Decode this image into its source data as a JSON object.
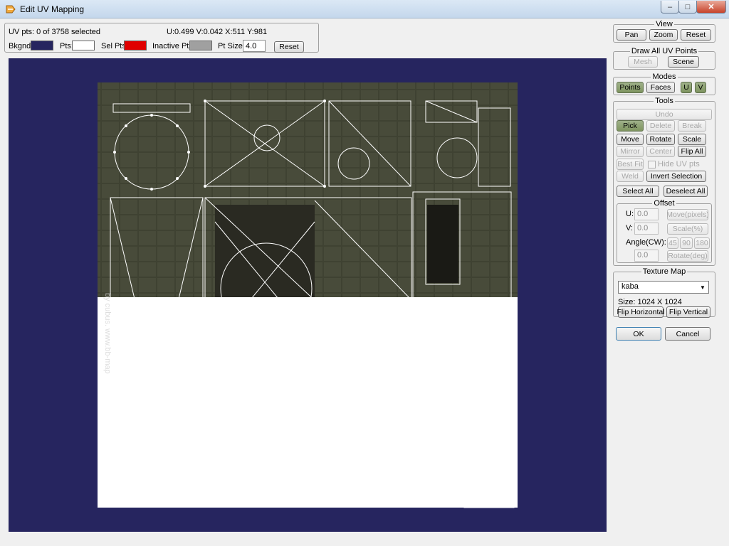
{
  "window": {
    "title": "Edit UV Mapping",
    "minimize": "–",
    "maximize": "□",
    "close": "✕"
  },
  "info": {
    "uv_pts": "UV pts: 0 of 3758 selected",
    "coords": "U:0.499  V:0.042  X:511  Y:981",
    "bkgnd_label": "Bkgnd:",
    "pts_label": "Pts:",
    "sel_pts_label": "Sel Pts:",
    "inactive_pts_label": "Inactive Pts:",
    "pt_size_label": "Pt Size:",
    "pt_size_value": "4.0",
    "reset": "Reset",
    "colors": {
      "bkgnd": "#26255f",
      "pts": "#ffffff",
      "sel_pts": "#e00000",
      "inactive_pts": "#a0a0a0"
    }
  },
  "view": {
    "label": "View",
    "pan": "Pan",
    "zoom": "Zoom",
    "reset": "Reset"
  },
  "draw_all": {
    "label": "Draw All UV Points",
    "mesh": "Mesh",
    "scene": "Scene"
  },
  "modes": {
    "label": "Modes",
    "points": "Points",
    "faces": "Faces",
    "u": "U",
    "v": "V"
  },
  "tools": {
    "label": "Tools",
    "undo": "Undo",
    "pick": "Pick",
    "delete": "Delete",
    "break": "Break",
    "move": "Move",
    "rotate": "Rotate",
    "scale": "Scale",
    "mirror": "Mirror",
    "center": "Center",
    "flip_all": "Flip All",
    "best_fit": "Best Fit",
    "hide_uv_pts": "Hide UV pts",
    "weld": "Weld",
    "invert_selection": "Invert Selection",
    "select_all": "Select All",
    "deselect_all": "Deselect All"
  },
  "offset": {
    "label": "Offset",
    "u_label": "U:",
    "u_value": "0.0",
    "v_label": "V:",
    "v_value": "0.0",
    "move_pixels": "Move(pixels)",
    "scale_pct": "Scale(%)",
    "angle_label": "Angle(CW):",
    "a45": "45",
    "a90": "90",
    "a180": "180",
    "angle_value": "0.0",
    "rotate_deg": "Rotate(deg)"
  },
  "texture": {
    "label": "Texture Map",
    "selected": "kaba",
    "size": "Size: 1024 X 1024",
    "flip_h": "Flip Horizontal",
    "flip_v": "Flip Vertical"
  },
  "dialog": {
    "ok": "OK",
    "cancel": "Cancel"
  },
  "texture_watermark": "by cubus. www.bb-map"
}
